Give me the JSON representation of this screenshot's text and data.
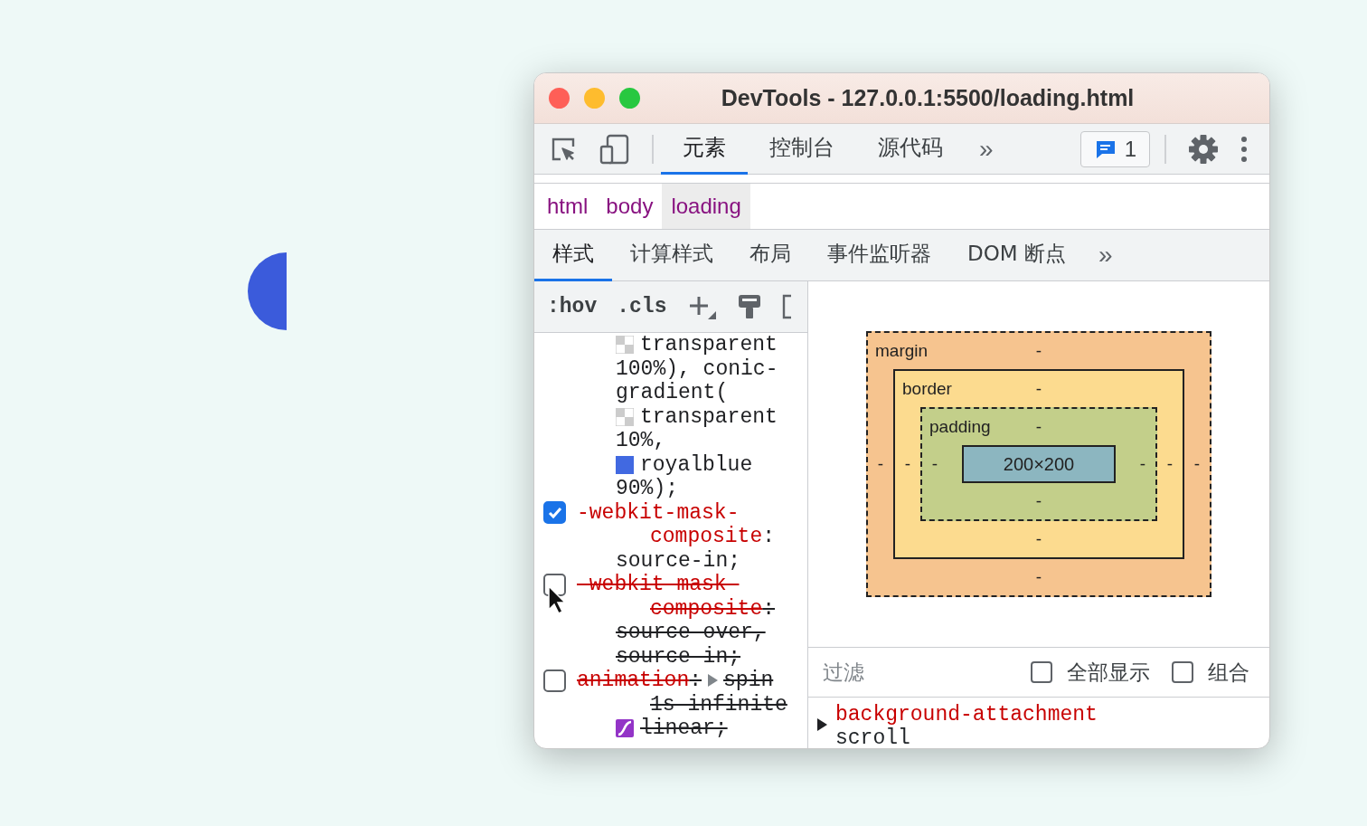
{
  "window": {
    "title": "DevTools - 127.0.0.1:5500/loading.html"
  },
  "toolbar": {
    "tabs": [
      {
        "label": "元素",
        "selected": true
      },
      {
        "label": "控制台",
        "selected": false
      },
      {
        "label": "源代码",
        "selected": false
      }
    ],
    "overflow": "»",
    "issues_count": "1"
  },
  "breadcrumb": [
    {
      "label": "html",
      "selected": false
    },
    {
      "label": "body",
      "selected": false
    },
    {
      "label": "loading",
      "selected": true
    }
  ],
  "panel_tabs": {
    "tabs": [
      {
        "label": "样式",
        "selected": true
      },
      {
        "label": "计算样式",
        "selected": false
      },
      {
        "label": "布局",
        "selected": false
      },
      {
        "label": "事件监听器",
        "selected": false
      },
      {
        "label": "DOM 断点",
        "selected": false
      }
    ],
    "overflow": "»"
  },
  "styles_toolbar": {
    "hov": ":hov",
    "cls": ".cls"
  },
  "styles": [
    {
      "kind": "continuation",
      "lines": [
        {
          "kind": "value",
          "tokens": [
            {
              "kind": "checker-swatch"
            },
            {
              "kind": "value",
              "text": "transparent"
            }
          ]
        },
        {
          "kind": "value",
          "tokens": [
            {
              "kind": "value",
              "text": "100%), conic-"
            }
          ]
        },
        {
          "kind": "value",
          "tokens": [
            {
              "kind": "value",
              "text": "gradient("
            }
          ]
        },
        {
          "kind": "value",
          "tokens": [
            {
              "kind": "checker-swatch"
            },
            {
              "kind": "value",
              "text": "transparent"
            }
          ]
        },
        {
          "kind": "value",
          "tokens": [
            {
              "kind": "value",
              "text": "10%,"
            }
          ]
        },
        {
          "kind": "value",
          "tokens": [
            {
              "kind": "color-swatch",
              "color": "#4169e1"
            },
            {
              "kind": "value",
              "text": "royalblue"
            }
          ]
        },
        {
          "kind": "value",
          "tokens": [
            {
              "kind": "value",
              "text": "90%);"
            }
          ]
        }
      ]
    },
    {
      "kind": "declaration",
      "checked": true,
      "cursor": false,
      "lines": [
        {
          "kind": "head",
          "tokens": [
            {
              "kind": "property",
              "text": "-webkit-mask-"
            }
          ]
        },
        {
          "kind": "wrap",
          "tokens": [
            {
              "kind": "property",
              "text": "composite"
            },
            {
              "kind": "value",
              "text": ":"
            }
          ]
        },
        {
          "kind": "value",
          "tokens": [
            {
              "kind": "value",
              "text": "source-in;"
            }
          ]
        }
      ]
    },
    {
      "kind": "declaration",
      "checked": false,
      "cursor": true,
      "lines": [
        {
          "kind": "head",
          "tokens": [
            {
              "kind": "property",
              "text": "-webkit-mask-"
            }
          ]
        },
        {
          "kind": "wrap",
          "tokens": [
            {
              "kind": "property",
              "text": "composite"
            },
            {
              "kind": "value",
              "text": ":"
            }
          ]
        },
        {
          "kind": "value",
          "tokens": [
            {
              "kind": "value",
              "text": "source-over,"
            }
          ]
        },
        {
          "kind": "value",
          "tokens": [
            {
              "kind": "value",
              "text": "source-in;"
            }
          ]
        }
      ]
    },
    {
      "kind": "declaration",
      "checked": false,
      "cursor": false,
      "lines": [
        {
          "kind": "head",
          "tokens": [
            {
              "kind": "property",
              "text": "animation"
            },
            {
              "kind": "value",
              "text": ":"
            },
            {
              "kind": "expander"
            },
            {
              "kind": "value",
              "text": "spin"
            }
          ]
        },
        {
          "kind": "wrap",
          "tokens": [
            {
              "kind": "value",
              "text": "1s infinite"
            }
          ]
        },
        {
          "kind": "value",
          "tokens": [
            {
              "kind": "easing-swatch"
            },
            {
              "kind": "value",
              "text": "linear;"
            }
          ]
        }
      ]
    }
  ],
  "box_model": {
    "kind": "margin",
    "label": "margin",
    "top": "-",
    "left": "-",
    "inner": {
      "kind": "border",
      "label": "border",
      "top": "-",
      "left": "-",
      "inner": {
        "kind": "padding",
        "label": "padding",
        "top": "-",
        "left": "-",
        "inner": {
          "kind": "content",
          "label": "200×200"
        },
        "right": "-",
        "bottom": "-"
      },
      "right": "-",
      "bottom": "-"
    },
    "right": "-",
    "bottom": "-"
  },
  "filter": {
    "placeholder": "过滤",
    "options": [
      {
        "label": "全部显示",
        "checked": false
      },
      {
        "label": "组合",
        "checked": false
      }
    ]
  },
  "computed": [
    {
      "property": "background-attachment",
      "value": "scroll",
      "expanded": false
    }
  ]
}
